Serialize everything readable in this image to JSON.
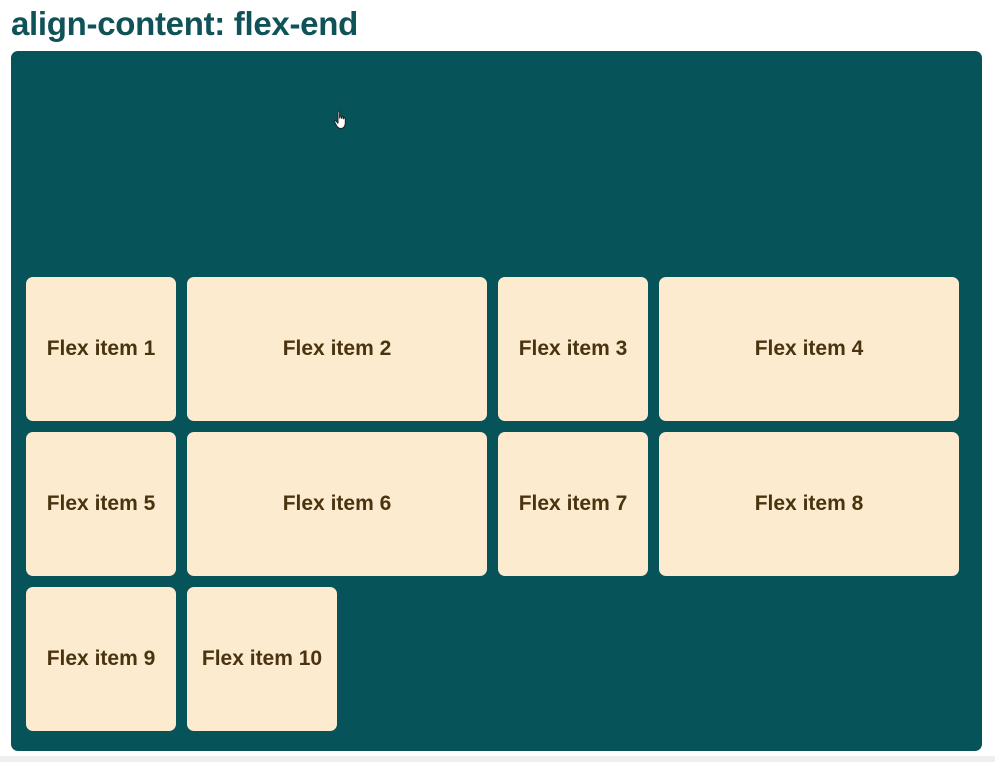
{
  "heading": "align-content: flex-end",
  "colors": {
    "heading": "#0f5257",
    "container_background": "#07535a",
    "item_background": "#fdebd0",
    "item_text": "#4a3410"
  },
  "items": [
    {
      "label": "Flex item 1"
    },
    {
      "label": "Flex item 2"
    },
    {
      "label": "Flex item 3"
    },
    {
      "label": "Flex item 4"
    },
    {
      "label": "Flex item 5"
    },
    {
      "label": "Flex item 6"
    },
    {
      "label": "Flex item 7"
    },
    {
      "label": "Flex item 8"
    },
    {
      "label": "Flex item 9"
    },
    {
      "label": "Flex item 10"
    }
  ],
  "cursor_icon": "hand-pointer-icon"
}
